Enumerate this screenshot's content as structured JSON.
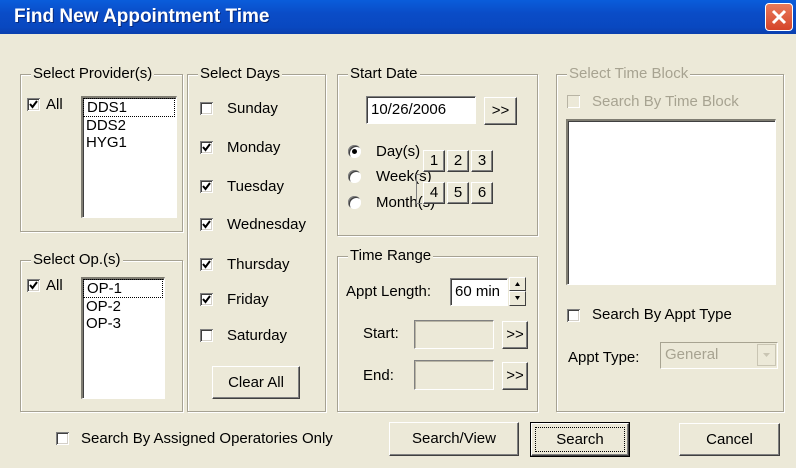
{
  "window": {
    "title": "Find New Appointment Time"
  },
  "providers": {
    "legend": "Select Provider(s)",
    "all_label": "All",
    "all_checked": true,
    "items": [
      "DDS1",
      "DDS2",
      "HYG1"
    ]
  },
  "operatories": {
    "legend": "Select Op.(s)",
    "all_label": "All",
    "all_checked": true,
    "items": [
      "OP-1",
      "OP-2",
      "OP-3"
    ]
  },
  "days": {
    "legend": "Select Days",
    "items": [
      {
        "label": "Sunday",
        "checked": false
      },
      {
        "label": "Monday",
        "checked": true
      },
      {
        "label": "Tuesday",
        "checked": true
      },
      {
        "label": "Wednesday",
        "checked": true
      },
      {
        "label": "Thursday",
        "checked": true
      },
      {
        "label": "Friday",
        "checked": true
      },
      {
        "label": "Saturday",
        "checked": false
      }
    ],
    "clear_all_label": "Clear All"
  },
  "start_date": {
    "legend": "Start Date",
    "value": "10/26/2006",
    "next_label": ">>",
    "units": [
      {
        "label": "Day(s)",
        "selected": true
      },
      {
        "label": "Week(s)",
        "selected": false
      },
      {
        "label": "Month(s)",
        "selected": false
      }
    ],
    "numbers": [
      "1",
      "2",
      "3",
      "4",
      "5",
      "6"
    ]
  },
  "time_range": {
    "legend": "Time Range",
    "appt_length_label": "Appt Length:",
    "appt_length_value": "60 min",
    "start_label": "Start:",
    "start_value": "",
    "end_label": "End:",
    "end_value": "",
    "picker_label": ">>"
  },
  "time_block": {
    "legend": "Select Time Block",
    "search_by_block_label": "Search By Time Block",
    "search_by_appt_type_label": "Search By Appt Type",
    "appt_type_label": "Appt Type:",
    "appt_type_value": "General"
  },
  "footer": {
    "assigned_only_label": "Search By Assigned Operatories Only",
    "search_view_label": "Search/View",
    "search_label": "Search",
    "cancel_label": "Cancel"
  },
  "colors": {
    "titlebar": "#0a4cc7",
    "dialog_bg": "#ece9d8",
    "close_button": "#d5442a",
    "disabled_text": "#a7a391"
  }
}
